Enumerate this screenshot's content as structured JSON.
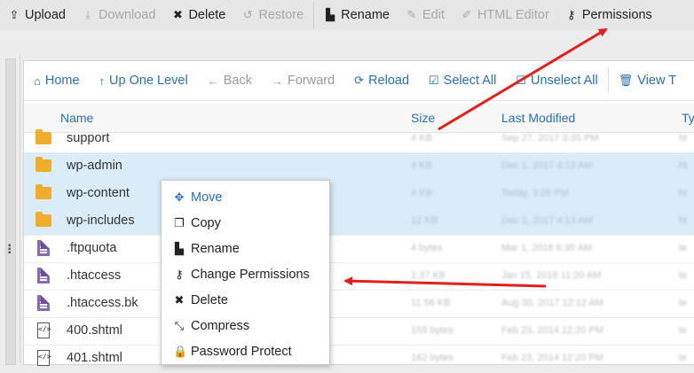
{
  "toolbar": {
    "items": [
      {
        "label": "Upload",
        "icon": "upload-icon",
        "glyph": "⇪",
        "enabled": true
      },
      {
        "label": "Download",
        "icon": "download-icon",
        "glyph": "⤓",
        "enabled": false
      },
      {
        "label": "Delete",
        "icon": "delete-icon",
        "glyph": "✖",
        "enabled": true
      },
      {
        "label": "Restore",
        "icon": "restore-icon",
        "glyph": "↺",
        "enabled": false
      },
      {
        "label": "Rename",
        "icon": "rename-icon",
        "glyph": "▙",
        "enabled": true
      },
      {
        "label": "Edit",
        "icon": "pencil-icon",
        "glyph": "✎",
        "enabled": false
      },
      {
        "label": "HTML Editor",
        "icon": "html-editor-icon",
        "glyph": "✐",
        "enabled": false
      },
      {
        "label": "Permissions",
        "icon": "key-icon",
        "glyph": "⚷",
        "enabled": true
      }
    ]
  },
  "nav": {
    "items": [
      {
        "label": "Home",
        "icon": "home-icon",
        "glyph": "⌂",
        "enabled": true
      },
      {
        "label": "Up One Level",
        "icon": "level-up-icon",
        "glyph": "↑",
        "enabled": true
      },
      {
        "label": "Back",
        "icon": "back-arrow-icon",
        "glyph": "←",
        "enabled": false
      },
      {
        "label": "Forward",
        "icon": "forward-arrow-icon",
        "glyph": "→",
        "enabled": false
      },
      {
        "label": "Reload",
        "icon": "reload-icon",
        "glyph": "⟳",
        "enabled": true
      },
      {
        "label": "Select All",
        "icon": "checkbox-checked-icon",
        "glyph": "☑",
        "enabled": true
      },
      {
        "label": "Unselect All",
        "icon": "checkbox-empty-icon",
        "glyph": "☐",
        "enabled": true
      },
      {
        "label": "View T",
        "icon": "trash-icon",
        "glyph": "🗑",
        "enabled": true
      }
    ]
  },
  "table": {
    "columns": {
      "name": "Name",
      "size": "Size",
      "modified": "Last Modified",
      "type": "Ty"
    },
    "rows": [
      {
        "name": "support",
        "kind": "folder",
        "selected": false,
        "size": "4 KB",
        "modified": "Sep 27, 2017 3:35 PM",
        "type": "ht"
      },
      {
        "name": "wp-admin",
        "kind": "folder",
        "selected": true,
        "size": "4 KB",
        "modified": "Dec 1, 2017 4:13 AM",
        "type": "ht"
      },
      {
        "name": "wp-content",
        "kind": "folder",
        "selected": true,
        "size": "4 KB",
        "modified": "Today, 3:26 PM",
        "type": "ht"
      },
      {
        "name": "wp-includes",
        "kind": "folder",
        "selected": true,
        "size": "12 KB",
        "modified": "Dec 1, 2017 4:13 AM",
        "type": "ht"
      },
      {
        "name": ".ftpquota",
        "kind": "doc",
        "selected": false,
        "size": "4 bytes",
        "modified": "Mar 1, 2018 6:35 AM",
        "type": "te"
      },
      {
        "name": ".htaccess",
        "kind": "doc",
        "selected": false,
        "size": "2.37 KB",
        "modified": "Jan 15, 2018 11:20 AM",
        "type": "te"
      },
      {
        "name": ".htaccess.bk",
        "kind": "doc",
        "selected": false,
        "size": "11.56 KB",
        "modified": "Aug 30, 2017 12:12 AM",
        "type": "te"
      },
      {
        "name": "400.shtml",
        "kind": "code",
        "selected": false,
        "size": "159 bytes",
        "modified": "Feb 23, 2014 12:20 PM",
        "type": "te"
      },
      {
        "name": "401.shtml",
        "kind": "code",
        "selected": false,
        "size": "162 bytes",
        "modified": "Feb 23, 2014 12:20 PM",
        "type": "te"
      }
    ]
  },
  "context_menu": {
    "items": [
      {
        "label": "Move",
        "icon": "move-arrows-icon",
        "glyph": "✥"
      },
      {
        "label": "Copy",
        "icon": "copy-icon",
        "glyph": "❐"
      },
      {
        "label": "Rename",
        "icon": "rename-icon",
        "glyph": "▙"
      },
      {
        "label": "Change Permissions",
        "icon": "key-icon",
        "glyph": "⚷"
      },
      {
        "label": "Delete",
        "icon": "delete-icon",
        "glyph": "✖"
      },
      {
        "label": "Compress",
        "icon": "compress-icon",
        "glyph": "⤡"
      },
      {
        "label": "Password Protect",
        "icon": "lock-icon",
        "glyph": "🔒"
      }
    ]
  },
  "colors": {
    "accent": "#2a6fb0",
    "selected_row": "#d9ecf7",
    "folder": "#f0ad2c",
    "arrow": "#e0201c"
  }
}
